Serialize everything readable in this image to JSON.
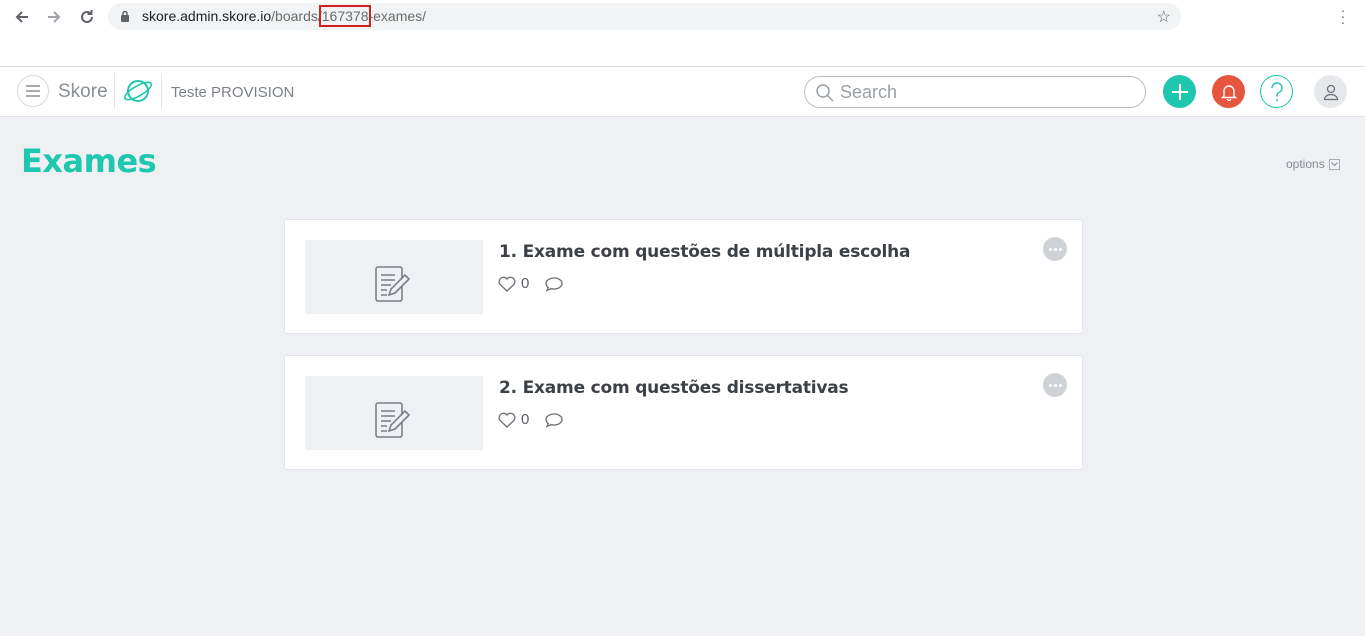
{
  "browser": {
    "url_host": "skore.admin.skore.io",
    "url_path_prefix": "/boards/",
    "url_board_id": "167378",
    "url_path_suffix": "-exames/"
  },
  "header": {
    "brand": "Skore",
    "workspace": "Teste PROVISION",
    "search_placeholder": "Search",
    "colors": {
      "add": "#1ec7ad",
      "notifications": "#e8553e",
      "help": "#1ec7ad"
    }
  },
  "page": {
    "title": "Exames",
    "options_label": "options"
  },
  "cards": [
    {
      "title": "1. Exame com questões de múltipla escolha",
      "likes": "0"
    },
    {
      "title": "2. Exame com questões dissertativas",
      "likes": "0"
    }
  ],
  "icons": {
    "thumbnail": "edit-document-icon",
    "like": "heart-icon",
    "comment": "comment-icon",
    "more": "more-dots-icon"
  }
}
